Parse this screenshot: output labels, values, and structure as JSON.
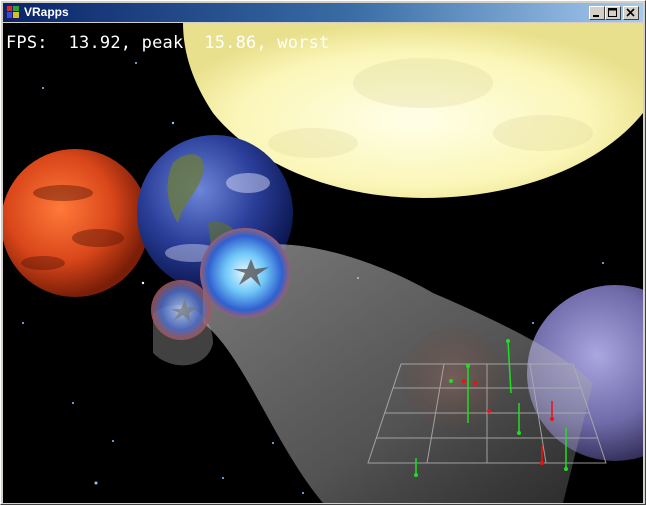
{
  "window": {
    "title": "VRapps",
    "icons": {
      "app": "vrapps-app-icon",
      "minimize": "minimize-icon",
      "maximize": "maximize-icon",
      "close": "close-icon"
    }
  },
  "hud": {
    "fps_text": "FPS:  13.92, peak  15.86, worst"
  },
  "colors": {
    "titlebar_start": "#0a246a",
    "titlebar_end": "#a6caf0",
    "marker_green": "#22dd22",
    "marker_red": "#ee1111",
    "grid": "#b0b0b0"
  }
}
